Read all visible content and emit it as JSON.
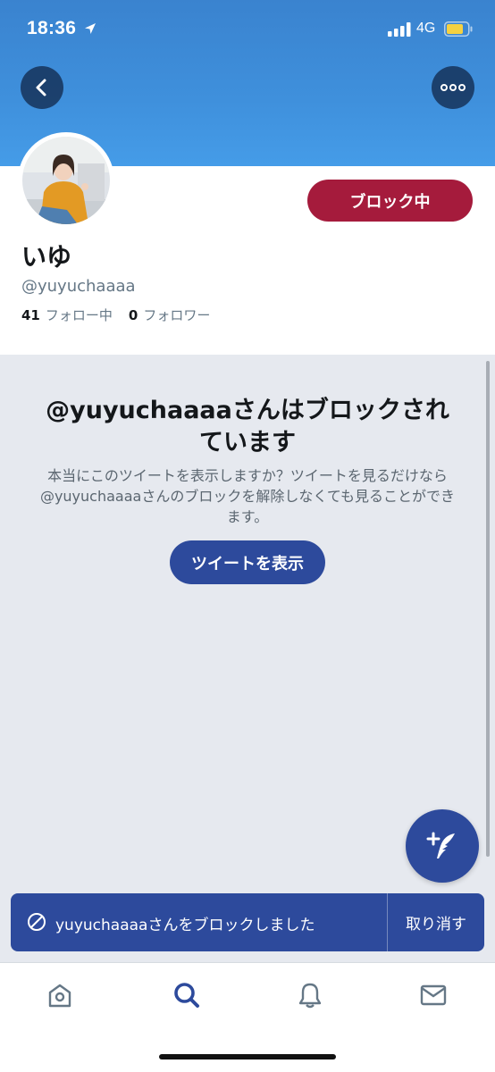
{
  "status_bar": {
    "time": "18:36",
    "network": "4G",
    "battery_color": "#f5d142"
  },
  "header": {
    "back_icon": "chevron-left-icon",
    "more_icon": "ellipsis-icon"
  },
  "profile": {
    "display_name": "いゆ",
    "handle": "@yuyuchaaaa",
    "following_count": "41",
    "following_label": "フォロー中",
    "followers_count": "0",
    "followers_label": "フォロワー",
    "blocking_button": "ブロック中"
  },
  "blocked_notice": {
    "title": "@yuyuchaaaaさんはブロックされています",
    "description": "本当にこのツイートを表示しますか？ツイートを見るだけなら@yuyuchaaaaさんのブロックを解除しなくても見ることができます。",
    "show_button": "ツイートを表示"
  },
  "toast": {
    "message": "yuyuchaaaaさんをブロックしました",
    "undo": "取り消す"
  },
  "tabs": [
    {
      "name": "home",
      "icon": "home-icon"
    },
    {
      "name": "search",
      "icon": "search-icon",
      "active": true
    },
    {
      "name": "notifications",
      "icon": "bell-icon"
    },
    {
      "name": "messages",
      "icon": "mail-icon"
    }
  ],
  "colors": {
    "banner": "#3f90dc",
    "primary": "#2d4a9c",
    "blocking": "#a51b3c",
    "panel": "#e6e9ef"
  }
}
